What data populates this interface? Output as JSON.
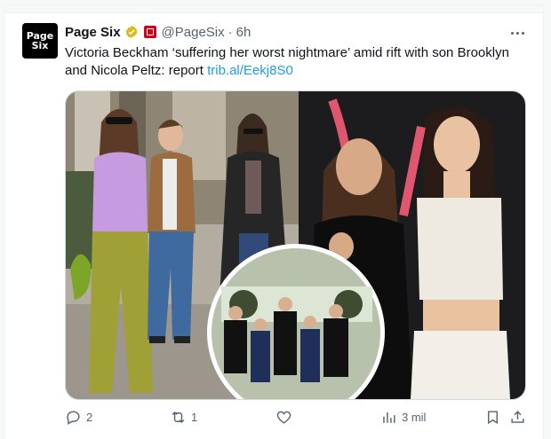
{
  "tweet": {
    "avatar_text_line1": "Page",
    "avatar_text_line2": "Six",
    "author_name": "Page Six",
    "handle": "@PageSix",
    "separator": "·",
    "time": "6h",
    "text_main": "Victoria Beckham ‘suffering her worst nightmare’ amid rift with son Brooklyn and Nicola Peltz: report ",
    "link_text": "trib.al/Eekj8S0"
  },
  "actions": {
    "reply_count": "2",
    "retweet_count": "1",
    "like_count": "",
    "views_count": "3 mil"
  },
  "icons": {
    "verified": "verified-badge-icon",
    "brand": "affiliate-badge-icon",
    "more": "more-icon",
    "reply": "reply-icon",
    "retweet": "retweet-icon",
    "like": "heart-icon",
    "views": "views-icon",
    "bookmark": "bookmark-icon",
    "share": "share-icon"
  },
  "colors": {
    "accent": "#1d9bf0",
    "secondary_text": "#536471",
    "verified_gold": "#e2b719",
    "brand_red": "#d0021b"
  }
}
